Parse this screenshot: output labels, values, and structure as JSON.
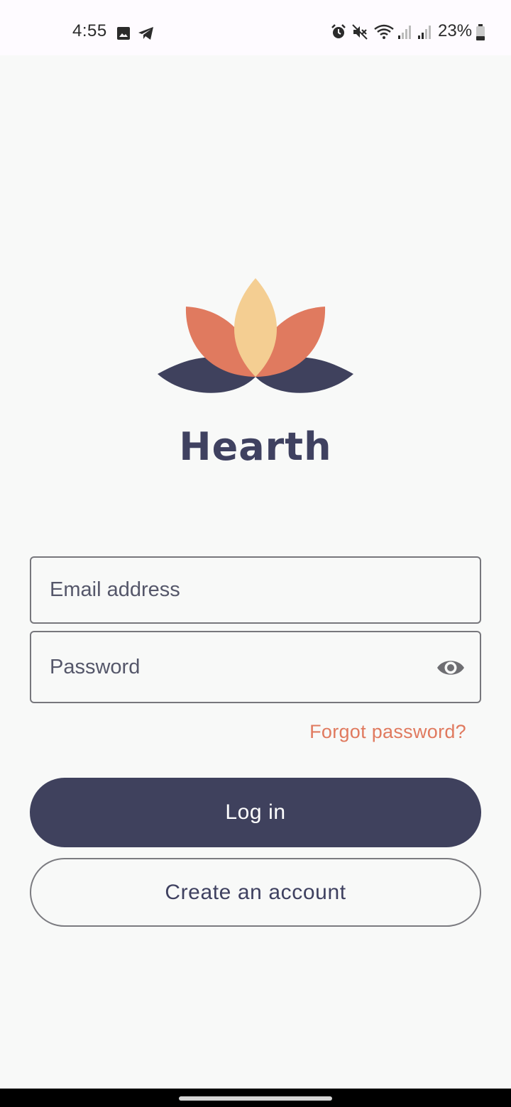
{
  "status_bar": {
    "time": "4:55",
    "battery": "23%",
    "icons": [
      "gallery-icon",
      "telegram-icon",
      "alarm-icon",
      "mute-icon",
      "wifi-icon",
      "signal-icon",
      "signal-icon",
      "battery-icon"
    ]
  },
  "brand": {
    "name": "Hearth",
    "colors": {
      "navy": "#3f415d",
      "coral": "#e07a5f",
      "peach": "#f4ce92"
    }
  },
  "login_form": {
    "email_placeholder": "Email address",
    "email_value": "",
    "password_placeholder": "Password",
    "password_value": "",
    "show_password_icon": "eye-icon",
    "forgot_password_label": "Forgot password?"
  },
  "actions": {
    "login_label": "Log in",
    "create_account_label": "Create an account"
  }
}
